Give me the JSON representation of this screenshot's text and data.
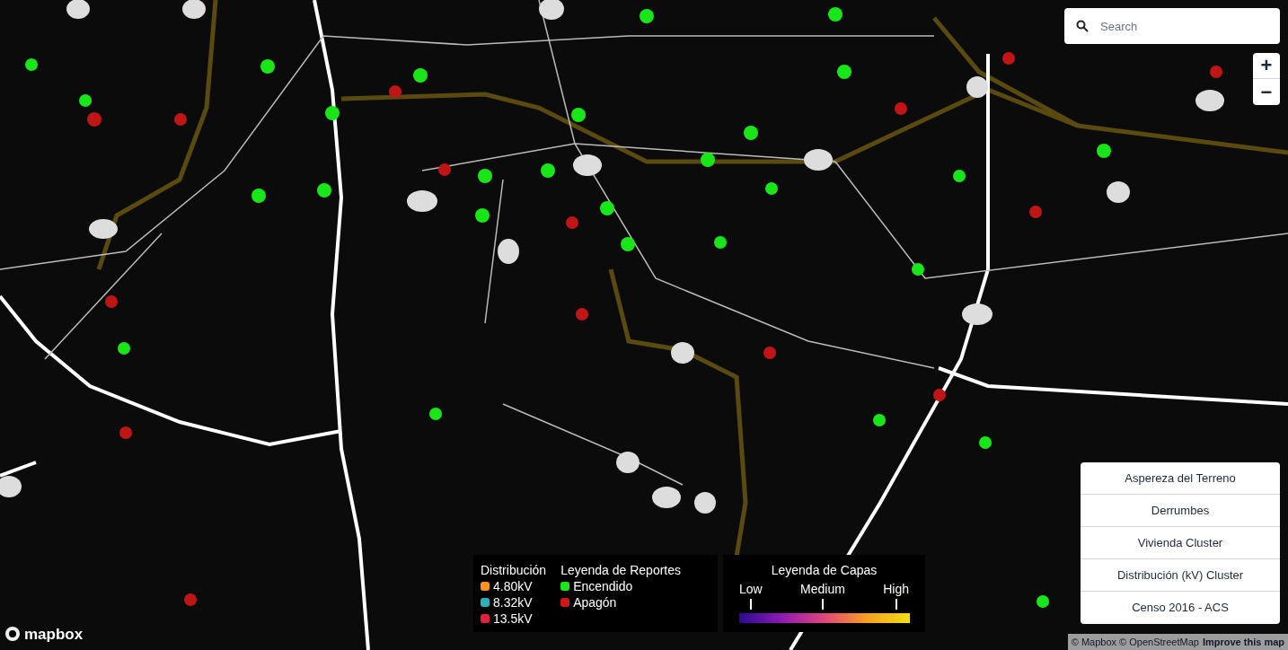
{
  "search": {
    "placeholder": "Search"
  },
  "zoom": {
    "in": "+",
    "out": "−"
  },
  "layers": [
    "Aspereza del Terreno",
    "Derrumbes",
    "Vivienda Cluster",
    "Distribución (kV) Cluster",
    "Censo 2016 - ACS"
  ],
  "legend_distribution": {
    "title": "Distribución",
    "items": [
      {
        "label": "4.80kV",
        "color": "#f7931e"
      },
      {
        "label": "8.32kV",
        "color": "#2ab3b8"
      },
      {
        "label": "13.5kV",
        "color": "#e0203c"
      }
    ]
  },
  "legend_reports": {
    "title": "Leyenda de Reportes",
    "items": [
      {
        "label": "Encendido",
        "color": "#19e619"
      },
      {
        "label": "Apagón",
        "color": "#d01818"
      }
    ]
  },
  "legend_layers": {
    "title": "Leyenda de Capas",
    "ticks": [
      "Low",
      "Medium",
      "High"
    ]
  },
  "logo": "mapbox",
  "attribution": {
    "text": "© Mapbox © OpenStreetMap",
    "link": "Improve this map"
  }
}
